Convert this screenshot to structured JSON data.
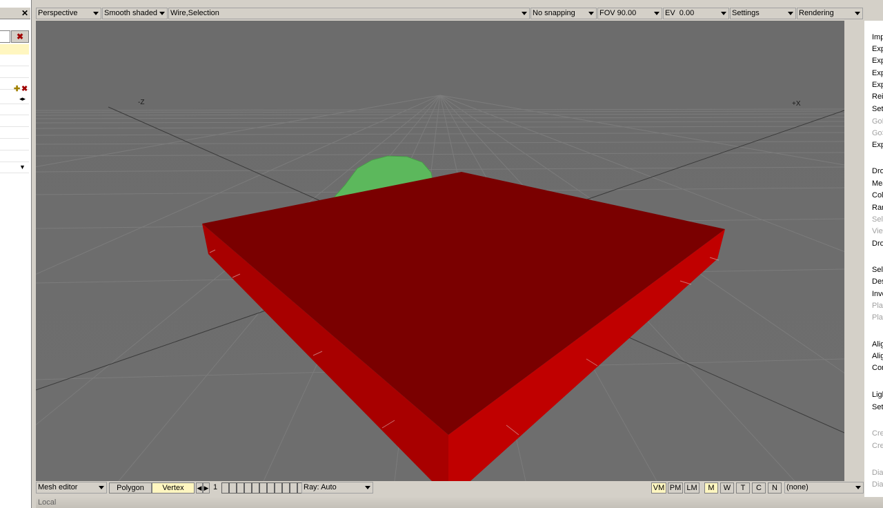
{
  "top_toolbar": {
    "view_mode": "Perspective",
    "shading": "Smooth shaded",
    "overlay": "Wire,Selection",
    "snapping": "No snapping",
    "fov": "FOV 90.00",
    "ev": "EV  0.00",
    "settings": "Settings",
    "rendering": "Rendering"
  },
  "viewport": {
    "axis_neg_z": "-Z",
    "axis_pos_x": "+X",
    "colors": {
      "background": "#676767",
      "box_top": "#7a0000",
      "box_side": "#c00000",
      "box_side_dark": "#a80000",
      "sphere": "#5cb85c"
    }
  },
  "right_menu": {
    "items": [
      {
        "label": "Import",
        "enabled": true
      },
      {
        "label": "Export",
        "enabled": true
      },
      {
        "label": "Export",
        "enabled": true
      },
      {
        "label": "Export",
        "enabled": true
      },
      {
        "label": "Export",
        "enabled": true
      },
      {
        "label": "Reimport",
        "enabled": true
      },
      {
        "label": "Set",
        "enabled": true
      },
      {
        "label": "GoE",
        "enabled": false
      },
      {
        "label": "GoS",
        "enabled": false
      },
      {
        "label": "Export",
        "enabled": true
      },
      {
        "label": "Drop",
        "enabled": true
      },
      {
        "label": "Measure",
        "enabled": true
      },
      {
        "label": "Color",
        "enabled": true
      },
      {
        "label": "Random",
        "enabled": true
      },
      {
        "label": "Select",
        "enabled": false
      },
      {
        "label": "View",
        "enabled": false
      },
      {
        "label": "Drop",
        "enabled": true
      },
      {
        "label": "Select",
        "enabled": true
      },
      {
        "label": "Deselect",
        "enabled": true
      },
      {
        "label": "Invert",
        "enabled": true
      },
      {
        "label": "Play",
        "enabled": false
      },
      {
        "label": "Play",
        "enabled": false
      },
      {
        "label": "Align",
        "enabled": true
      },
      {
        "label": "Align",
        "enabled": true
      },
      {
        "label": "Convert",
        "enabled": true
      },
      {
        "label": "Light",
        "enabled": true
      },
      {
        "label": "Set",
        "enabled": true
      },
      {
        "label": "Create",
        "enabled": false
      },
      {
        "label": "Create",
        "enabled": false
      },
      {
        "label": "Diag",
        "enabled": false
      },
      {
        "label": "Diag",
        "enabled": false
      }
    ]
  },
  "bottom_bar": {
    "editor": "Mesh editor",
    "polygon": "Polygon",
    "vertex": "Vertex",
    "frame": "1",
    "ray": "Ray: Auto",
    "vm": "VM",
    "pm": "PM",
    "lm": "LM",
    "m": "M",
    "w": "W",
    "t": "T",
    "c": "C",
    "n": "N",
    "target": "(none)"
  },
  "status_bar": {
    "text": "Local"
  }
}
